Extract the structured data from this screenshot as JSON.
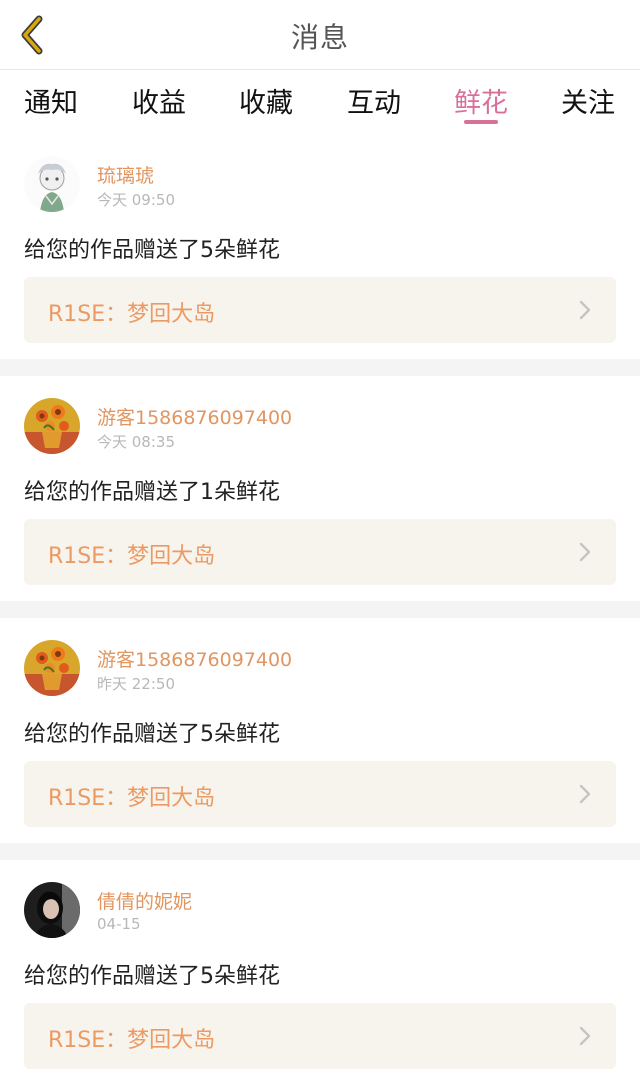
{
  "header": {
    "title": "消息",
    "back_icon": "chevron-left-icon",
    "accent_color": "#d9a80f"
  },
  "tabs": [
    {
      "label": "通知",
      "active": false
    },
    {
      "label": "收益",
      "active": false
    },
    {
      "label": "收藏",
      "active": false
    },
    {
      "label": "互动",
      "active": false
    },
    {
      "label": "鲜花",
      "active": true
    },
    {
      "label": "关注",
      "active": false
    }
  ],
  "colors": {
    "active_tab": "#d9709a",
    "username": "#e19661",
    "work_title": "#ec9a63",
    "work_bg": "#f6f4ed"
  },
  "messages": [
    {
      "username": "琉璃琥",
      "time": "今天 09:50",
      "text": "给您的作品赠送了5朵鲜花",
      "work_title": "R1SE：梦回大岛",
      "avatar": "anime-sketch-avatar"
    },
    {
      "username": "游客1586876097400",
      "time": "今天 08:35",
      "text": "给您的作品赠送了1朵鲜花",
      "work_title": "R1SE：梦回大岛",
      "avatar": "sunflower-painting-avatar"
    },
    {
      "username": "游客1586876097400",
      "time": "昨天 22:50",
      "text": "给您的作品赠送了5朵鲜花",
      "work_title": "R1SE：梦回大岛",
      "avatar": "sunflower-painting-avatar"
    },
    {
      "username": "倩倩的妮妮",
      "time": "04-15",
      "text": "给您的作品赠送了5朵鲜花",
      "work_title": "R1SE：梦回大岛",
      "avatar": "dark-portrait-avatar"
    }
  ]
}
